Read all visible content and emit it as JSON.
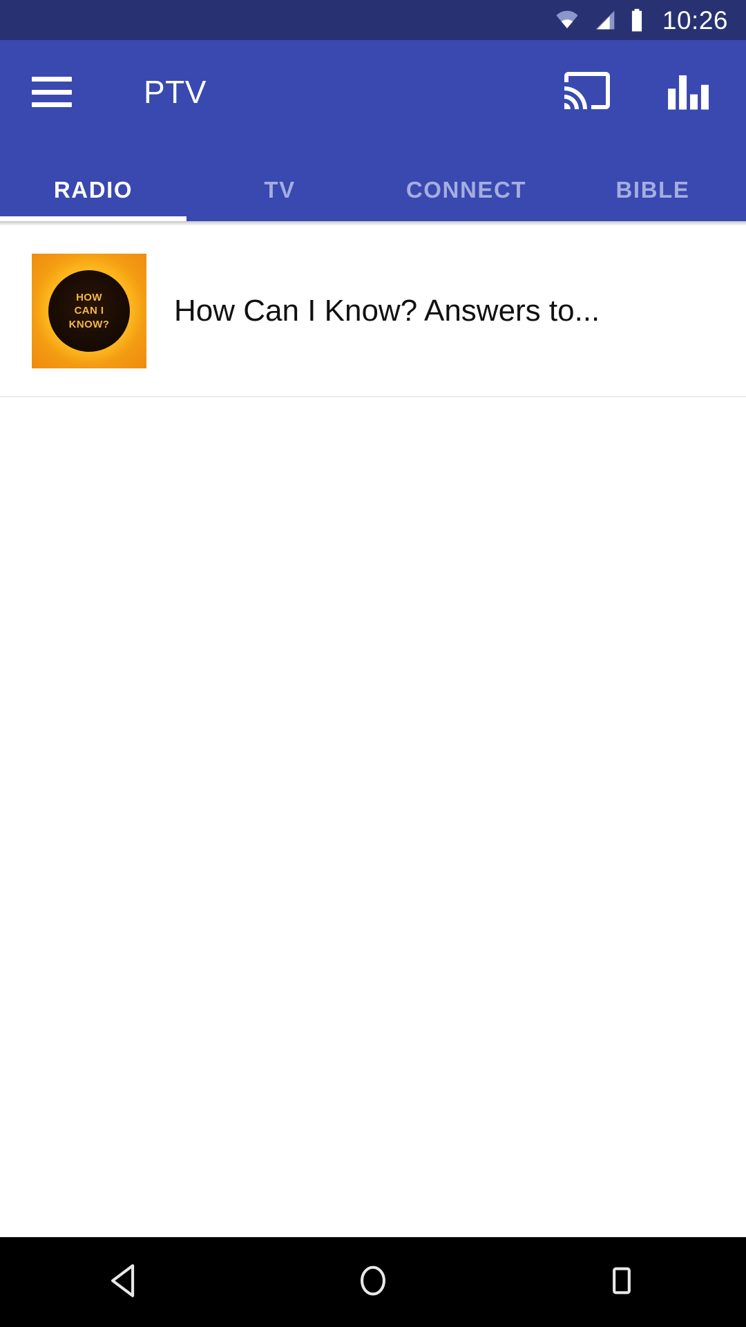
{
  "status_bar": {
    "time": "10:26",
    "background_color": "#283272",
    "icons": [
      "wifi-icon",
      "cell-signal-icon",
      "battery-icon"
    ]
  },
  "app_bar": {
    "title": "PTV",
    "background_color": "#3949b0",
    "menu_icon": "hamburger-menu-icon",
    "actions": [
      {
        "name": "cast-icon",
        "label": "Cast"
      },
      {
        "name": "equalizer-icon",
        "label": "Equalizer"
      }
    ]
  },
  "tabs": {
    "active_index": 0,
    "items": [
      {
        "label": "RADIO"
      },
      {
        "label": "TV"
      },
      {
        "label": "CONNECT"
      },
      {
        "label": "BIBLE"
      }
    ],
    "active_color": "#ffffff",
    "inactive_color": "#a4aee0"
  },
  "list": {
    "items": [
      {
        "title": "How Can I Know? Answers to...",
        "thumbnail": {
          "name": "how-can-i-know-album-art",
          "lines": [
            "HOW",
            "CAN I",
            "KNOW?"
          ],
          "text_color": "#f5b942",
          "background_color": "#fbb418"
        }
      }
    ]
  },
  "nav_bar": {
    "background_color": "#000000",
    "buttons": [
      {
        "name": "back-button",
        "icon": "triangle-left-icon"
      },
      {
        "name": "home-button",
        "icon": "circle-icon"
      },
      {
        "name": "recents-button",
        "icon": "square-icon"
      }
    ]
  }
}
